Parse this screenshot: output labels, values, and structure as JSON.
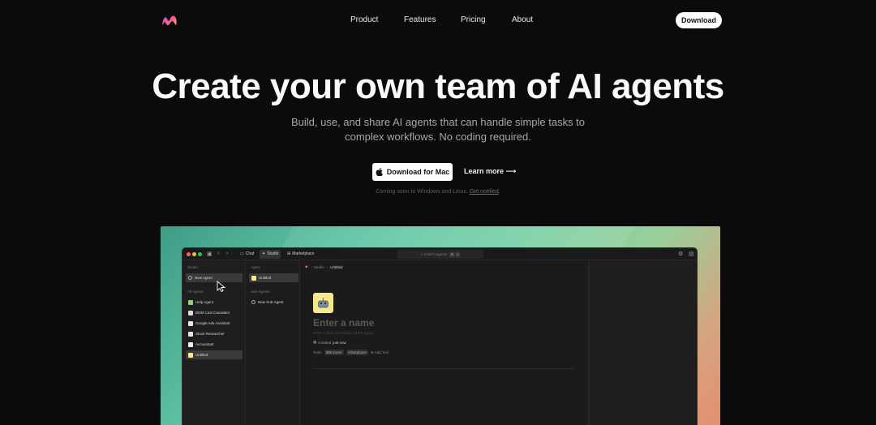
{
  "nav": {
    "links": [
      "Product",
      "Features",
      "Pricing",
      "About"
    ],
    "download_label": "Download"
  },
  "hero": {
    "title": "Create your own team of AI agents",
    "subtitle_line1": "Build, use, and share AI agents that can handle simple tasks to",
    "subtitle_line2": "complex workflows. No coding required.",
    "primary_button": "Download for Mac",
    "secondary_button": "Learn more",
    "coming_soon": "Coming soon to Windows and Linux.",
    "get_notified": "Get notified"
  },
  "app": {
    "tabs": [
      "Chat",
      "Studio",
      "Marketplace"
    ],
    "search_placeholder": "Search agents",
    "search_kbd": [
      "⌘",
      "K"
    ],
    "col1": {
      "studio_label": "Studio",
      "new_agent": "New Agent",
      "all_agents_label": "All Agents",
      "agents": [
        {
          "label": "Help Agent",
          "color": "#8fd17f"
        },
        {
          "label": "BOM Cost Calculator",
          "color": "#dddddd"
        },
        {
          "label": "Google Ads Assistant",
          "color": "#e9e9e9"
        },
        {
          "label": "Stock Researcher",
          "color": "#e6e6e6"
        },
        {
          "label": "Accountant",
          "color": "#eeeeee"
        },
        {
          "label": "Untitled",
          "color": "#f5e98c"
        }
      ]
    },
    "col2": {
      "agent_label": "Agent",
      "agent_item": "Untitled",
      "sub_agents_label": "Sub-Agents",
      "new_sub_agent": "New Sub-Agent"
    },
    "main": {
      "crumb_studio": "Studio",
      "crumb_current": "Untitled",
      "name_placeholder": "Enter a name",
      "desc_placeholder": "Enter a short description of the agent",
      "created_label": "Created",
      "created_value": "just now",
      "tools_label": "Tools",
      "tool_browser": "Browser",
      "tool_database": "Database",
      "add_tool": "Add Tool"
    }
  },
  "colors": {
    "background": "#0b0b0b",
    "accent_yellow": "#f5e98c",
    "gradient_teal": "#5fc4a5",
    "gradient_orange": "#e4906f"
  }
}
